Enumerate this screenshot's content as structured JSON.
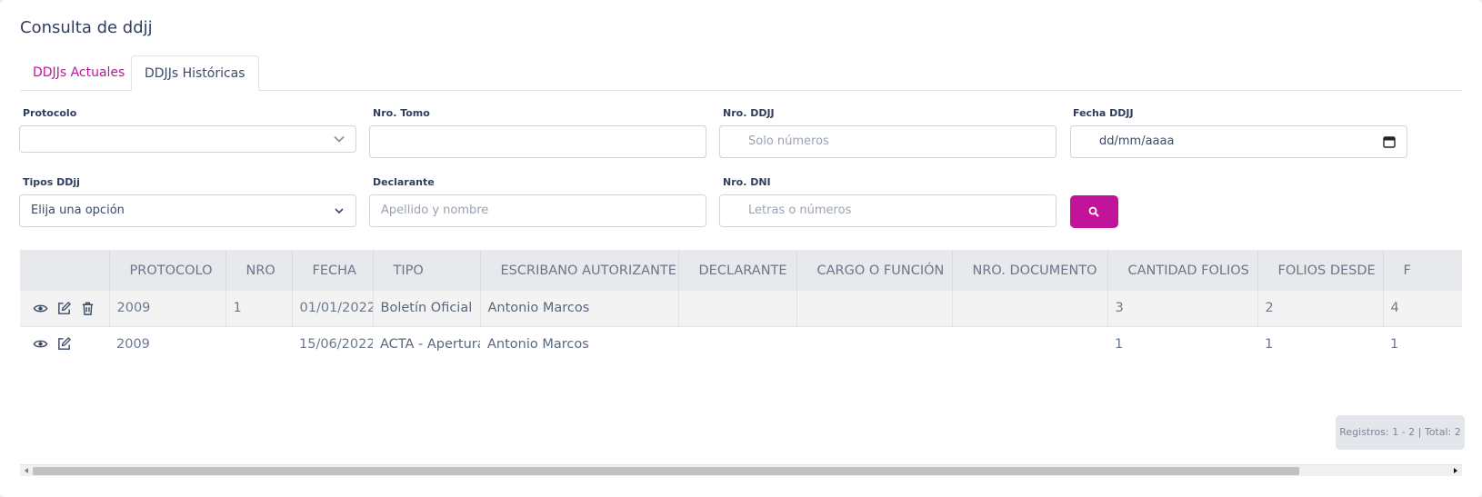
{
  "page": {
    "title": "Consulta de ddjj"
  },
  "tabs": [
    {
      "label": "DDJJs Actuales"
    },
    {
      "label": "DDJJs Históricas"
    }
  ],
  "filters": {
    "protocolo": {
      "label": "Protocolo",
      "value": ""
    },
    "nro_tomo": {
      "label": "Nro. Tomo",
      "value": ""
    },
    "nro_ddjj": {
      "label": "Nro. DDJJ",
      "placeholder": "Solo números"
    },
    "fecha_ddjj": {
      "label": "Fecha DDJJ",
      "placeholder": "dd/mm/aaaa"
    },
    "tipos_ddjj": {
      "label": "Tipos DDjj",
      "value": "Elija una opción"
    },
    "declarante": {
      "label": "Declarante",
      "placeholder": "Apellido y nombre"
    },
    "nro_dni": {
      "label": "Nro. DNI",
      "placeholder": "Letras o números"
    }
  },
  "table": {
    "columns": [
      "",
      "PROTOCOLO",
      "NRO",
      "FECHA",
      "TIPO",
      "ESCRIBANO AUTORIZANTE",
      "DECLARANTE",
      "CARGO O FUNCIÓN",
      "NRO. DOCUMENTO",
      "CANTIDAD FOLIOS",
      "FOLIOS DESDE",
      "F"
    ],
    "rows": [
      {
        "protocolo": "2009",
        "nro": "1",
        "fecha": "01/01/2022",
        "tipo": "Boletín Oficial",
        "escribano": "Antonio Marcos",
        "declarante": "",
        "cargo": "",
        "documento": "",
        "cantidad_folios": "3",
        "folios_desde": "2",
        "folios_hasta": "4"
      },
      {
        "protocolo": "2009",
        "nro": "",
        "fecha": "15/06/2022",
        "tipo": "ACTA - Apertura",
        "escribano": "Antonio Marcos",
        "declarante": "",
        "cargo": "",
        "documento": "",
        "cantidad_folios": "1",
        "folios_desde": "1",
        "folios_hasta": "1"
      }
    ]
  },
  "footer": {
    "records": "Registros: 1 - 2 | Total: 2"
  },
  "colors": {
    "accent": "#c2149b",
    "header_bg": "#e7e9ec",
    "text": "#344563"
  }
}
